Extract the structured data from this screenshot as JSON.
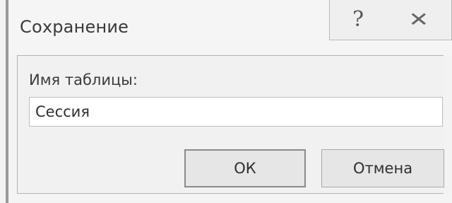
{
  "dialog": {
    "title": "Сохранение",
    "help_icon": "question-mark-icon",
    "close_icon": "close-x-icon"
  },
  "form": {
    "label": "Имя таблицы:",
    "input_value": "Сессия"
  },
  "buttons": {
    "ok_label": "ОК",
    "cancel_label": "Отмена"
  },
  "colors": {
    "dialog_background": "#f3f3f3",
    "button_background": "#e6e6e6",
    "border": "#b3b3b3"
  }
}
